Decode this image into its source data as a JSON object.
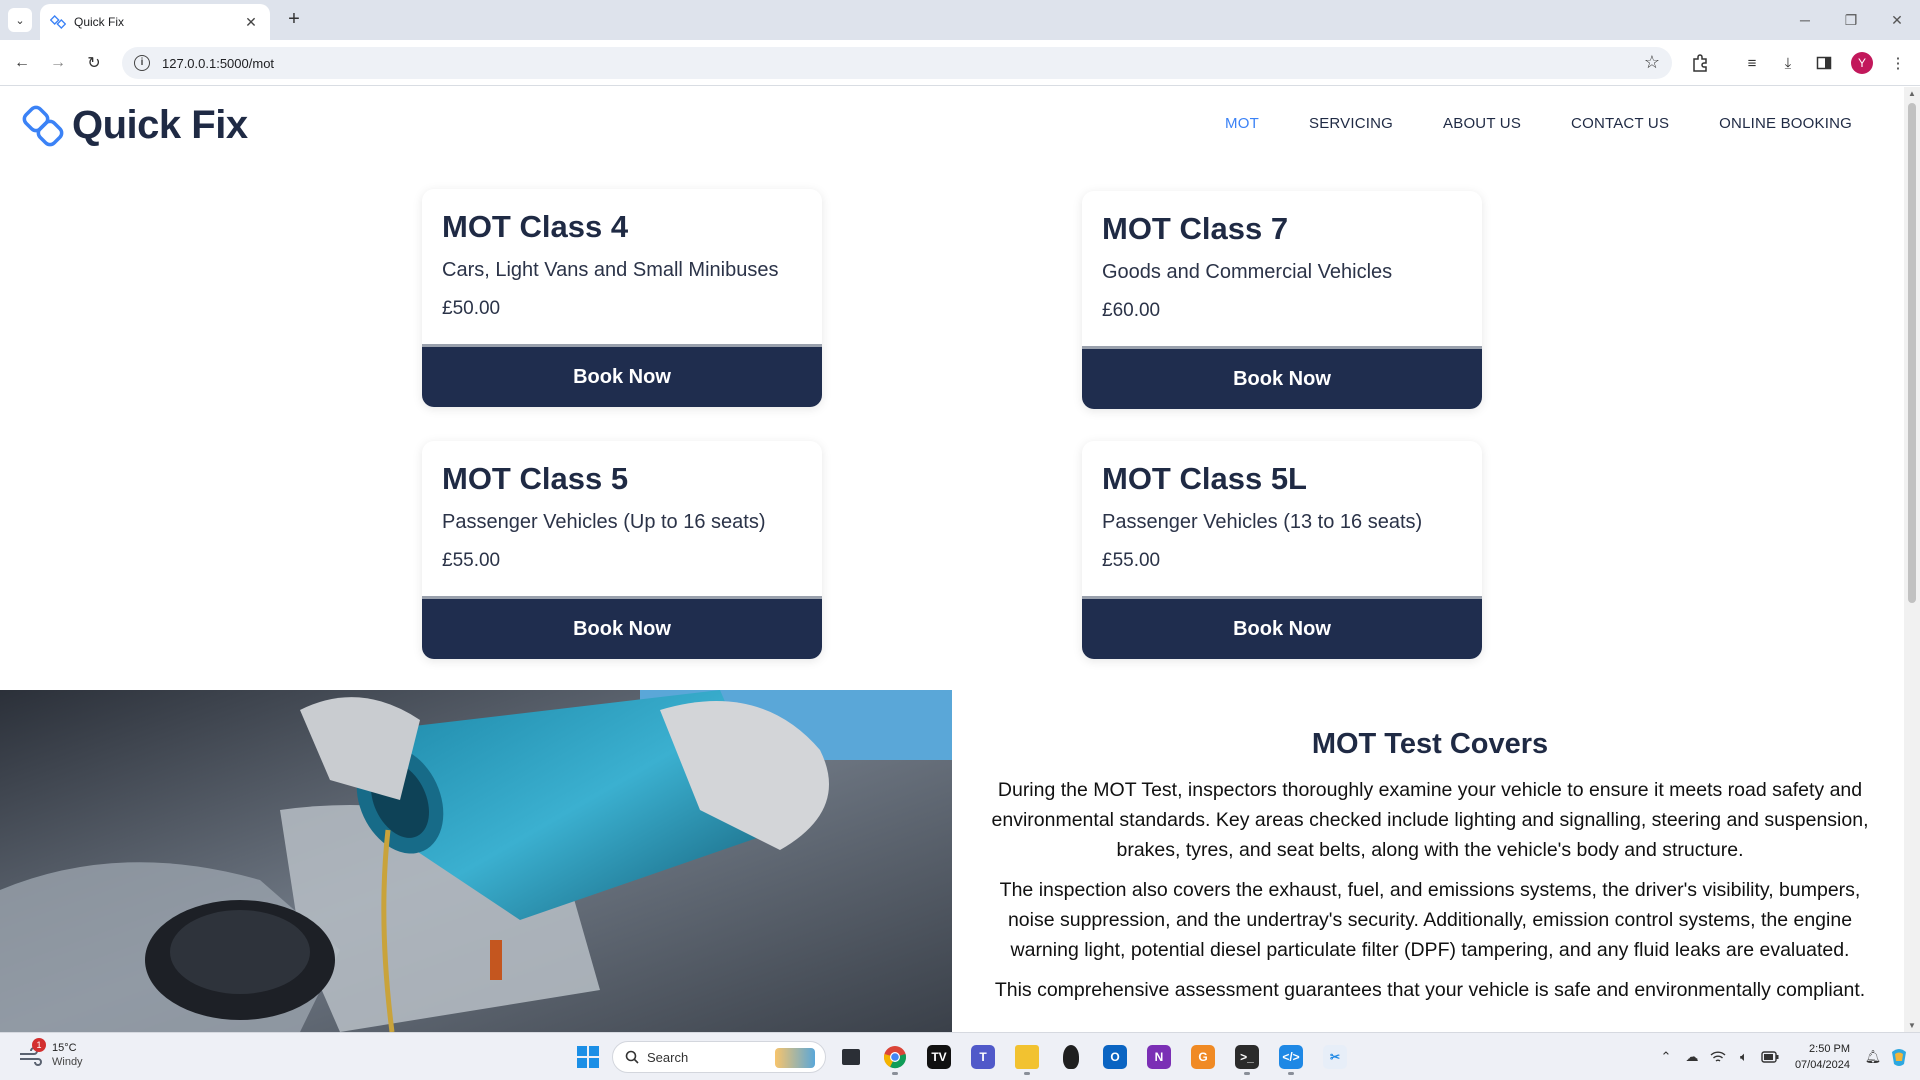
{
  "browser": {
    "tab_title": "Quick Fix",
    "url": "127.0.0.1:5000/mot",
    "profile_initial": "Y"
  },
  "site": {
    "brand": "Quick Fix",
    "nav": [
      "MOT",
      "SERVICING",
      "ABOUT US",
      "CONTACT US",
      "ONLINE BOOKING"
    ],
    "active_nav": "MOT",
    "accent_color": "#3b82f6",
    "primary_color": "#1f2d4e"
  },
  "cards": [
    {
      "title": "MOT Class 4",
      "description": "Cars, Light Vans and Small Minibuses",
      "price": "£50.00",
      "button": "Book Now"
    },
    {
      "title": "MOT Class 7",
      "description": "Goods and Commercial Vehicles",
      "price": "£60.00",
      "button": "Book Now"
    },
    {
      "title": "MOT Class 5",
      "description": "Passenger Vehicles (Up to 16 seats)",
      "price": "£55.00",
      "button": "Book Now"
    },
    {
      "title": "MOT Class 5L",
      "description": "Passenger Vehicles (13 to 16 seats)",
      "price": "£55.00",
      "button": "Book Now"
    }
  ],
  "info": {
    "title": "MOT Test Covers",
    "paragraphs": [
      "During the MOT Test, inspectors thoroughly examine your vehicle to ensure it meets road safety and environmental standards. Key areas checked include lighting and signalling, steering and suspension, brakes, tyres, and seat belts, along with the vehicle's body and structure.",
      "The inspection also covers the exhaust, fuel, and emissions systems, the driver's visibility, bumpers, noise suppression, and the undertray's security. Additionally, emission control systems, the engine warning light, potential diesel particulate filter (DPF) tampering, and any fluid leaks are evaluated.",
      "This comprehensive assessment guarantees that your vehicle is safe and environmentally compliant."
    ]
  },
  "taskbar": {
    "weather_temp": "15°C",
    "weather_desc": "Windy",
    "weather_badge": "1",
    "search_label": "Search",
    "time": "2:50 PM",
    "date": "07/04/2024"
  }
}
